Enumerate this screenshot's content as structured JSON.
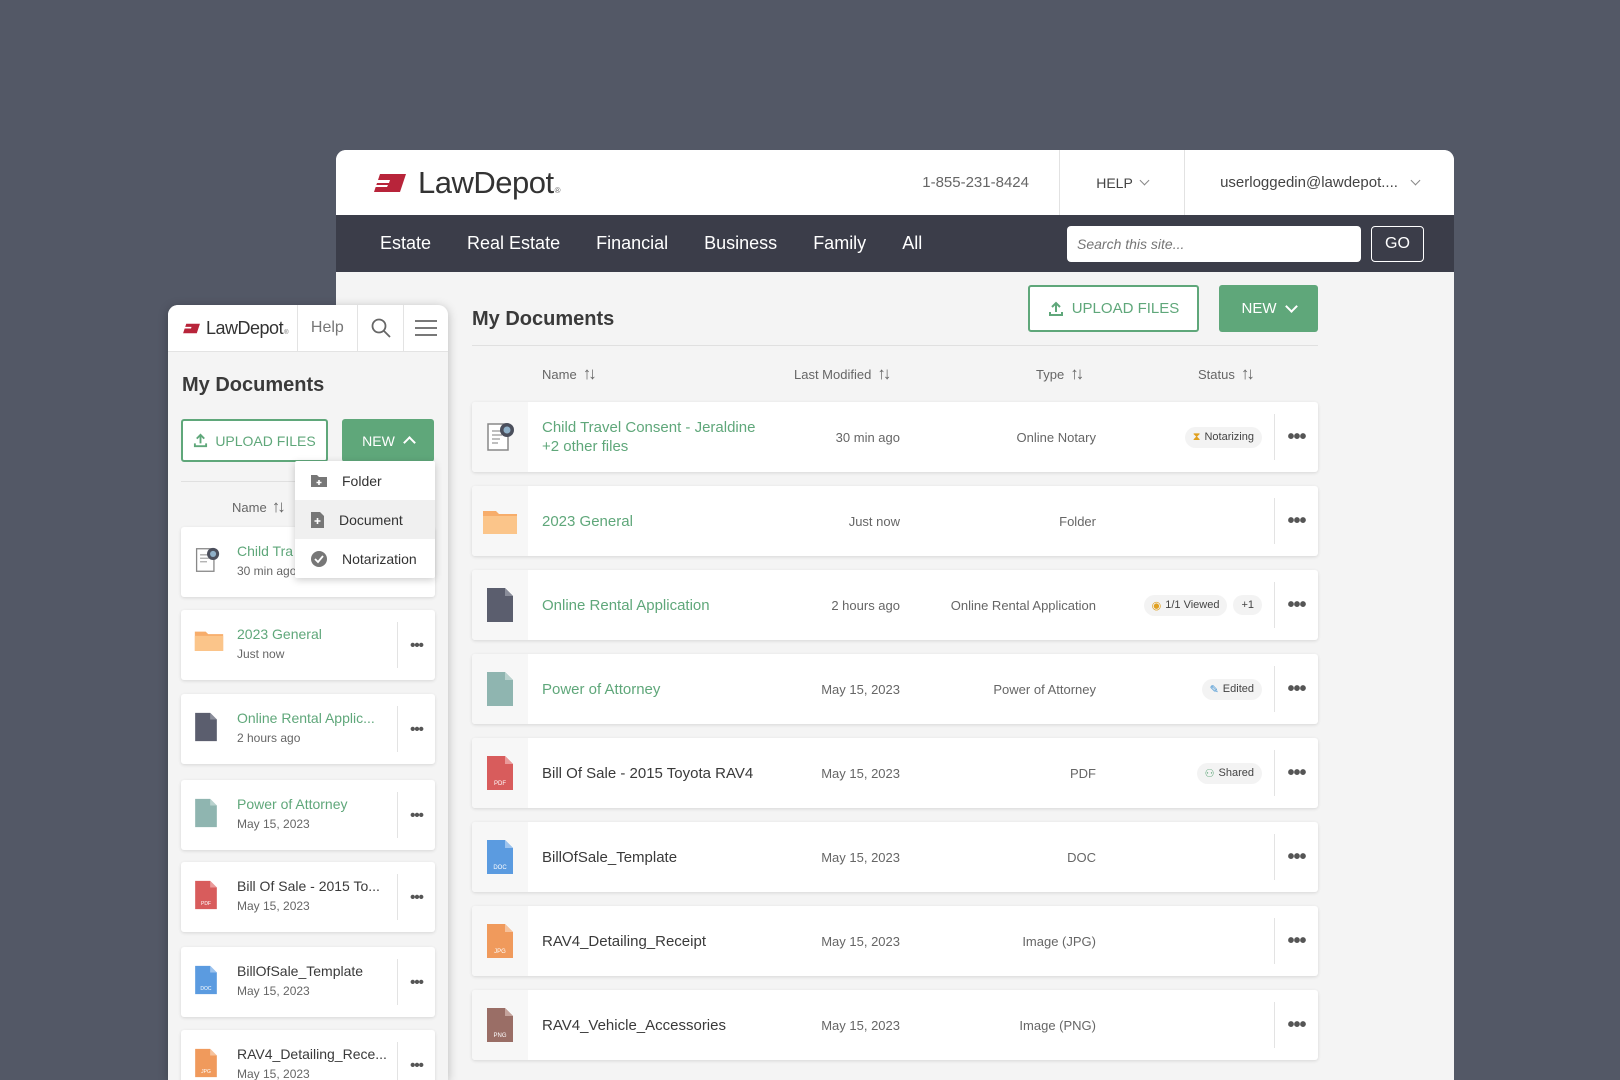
{
  "brand": {
    "name_bold": "Law",
    "name_rest": "Depot",
    "reg": "®"
  },
  "header": {
    "phone": "1-855-231-8424",
    "help_label": "HELP",
    "user_email": "userloggedin@lawdepot...."
  },
  "nav": {
    "items": [
      "Estate",
      "Real Estate",
      "Financial",
      "Business",
      "Family",
      "All"
    ],
    "search_placeholder": "Search this site...",
    "go_label": "GO"
  },
  "main": {
    "title": "My Documents",
    "upload_label": "UPLOAD FILES",
    "new_label": "NEW",
    "columns": {
      "name": "Name",
      "modified": "Last Modified",
      "type": "Type",
      "status": "Status"
    },
    "more_label": "•••",
    "rows": [
      {
        "name": "Child Travel Consent - Jeraldine",
        "name2": "+2 other files",
        "modified": "30 min ago",
        "type": "Online Notary",
        "status": "Notarizing",
        "status_extra": "",
        "icon": "notary-icon",
        "link": true
      },
      {
        "name": "2023 General",
        "name2": "",
        "modified": "Just now",
        "type": "Folder",
        "status": "",
        "status_extra": "",
        "icon": "folder-icon",
        "link": true
      },
      {
        "name": "Online Rental Application",
        "name2": "",
        "modified": "2 hours ago",
        "type": "Online Rental Application",
        "status": "1/1 Viewed",
        "status_extra": "+1",
        "icon": "document-dark-icon",
        "link": true
      },
      {
        "name": "Power of Attorney",
        "name2": "",
        "modified": "May 15, 2023",
        "type": "Power of Attorney",
        "status": "Edited",
        "status_extra": "",
        "icon": "document-teal-icon",
        "link": true
      },
      {
        "name": "Bill Of Sale - 2015 Toyota RAV4",
        "name2": "",
        "modified": "May 15, 2023",
        "type": "PDF",
        "status": "Shared",
        "status_extra": "",
        "icon": "pdf-file-icon",
        "link": false
      },
      {
        "name": "BillOfSale_Template",
        "name2": "",
        "modified": "May 15, 2023",
        "type": "DOC",
        "status": "",
        "status_extra": "",
        "icon": "doc-file-icon",
        "link": false
      },
      {
        "name": "RAV4_Detailing_Receipt",
        "name2": "",
        "modified": "May 15, 2023",
        "type": "Image (JPG)",
        "status": "",
        "status_extra": "",
        "icon": "jpg-file-icon",
        "link": false
      },
      {
        "name": "RAV4_Vehicle_Accessories",
        "name2": "",
        "modified": "May 15, 2023",
        "type": "Image (PNG)",
        "status": "",
        "status_extra": "",
        "icon": "png-file-icon",
        "link": false
      }
    ]
  },
  "mobile": {
    "help_label": "Help",
    "title": "My Documents",
    "upload_label": "UPLOAD FILES",
    "new_label": "NEW",
    "name_col": "Name",
    "dropdown": [
      "Folder",
      "Document",
      "Notarization"
    ],
    "rows": [
      {
        "name": "Child Tra",
        "date": "30 min ago",
        "link": true
      },
      {
        "name": "2023 General",
        "date": "Just now",
        "link": true
      },
      {
        "name": "Online Rental Applic...",
        "date": "2 hours ago",
        "link": true
      },
      {
        "name": "Power of Attorney",
        "date": "May 15, 2023",
        "link": true
      },
      {
        "name": "Bill Of Sale - 2015 To...",
        "date": "May 15, 2023",
        "link": false
      },
      {
        "name": "BillOfSale_Template",
        "date": "May 15, 2023",
        "link": false
      },
      {
        "name": "RAV4_Detailing_Rece...",
        "date": "May 15, 2023",
        "link": false
      }
    ]
  },
  "file_labels": {
    "pdf": "PDF",
    "doc": "DOC",
    "jpg": "JPG",
    "png": "PNG"
  },
  "colors": {
    "accent": "#5fa77a",
    "nav_bg": "#3b3d49",
    "page_bg": "#535866",
    "brand_red": "#b8243a"
  }
}
